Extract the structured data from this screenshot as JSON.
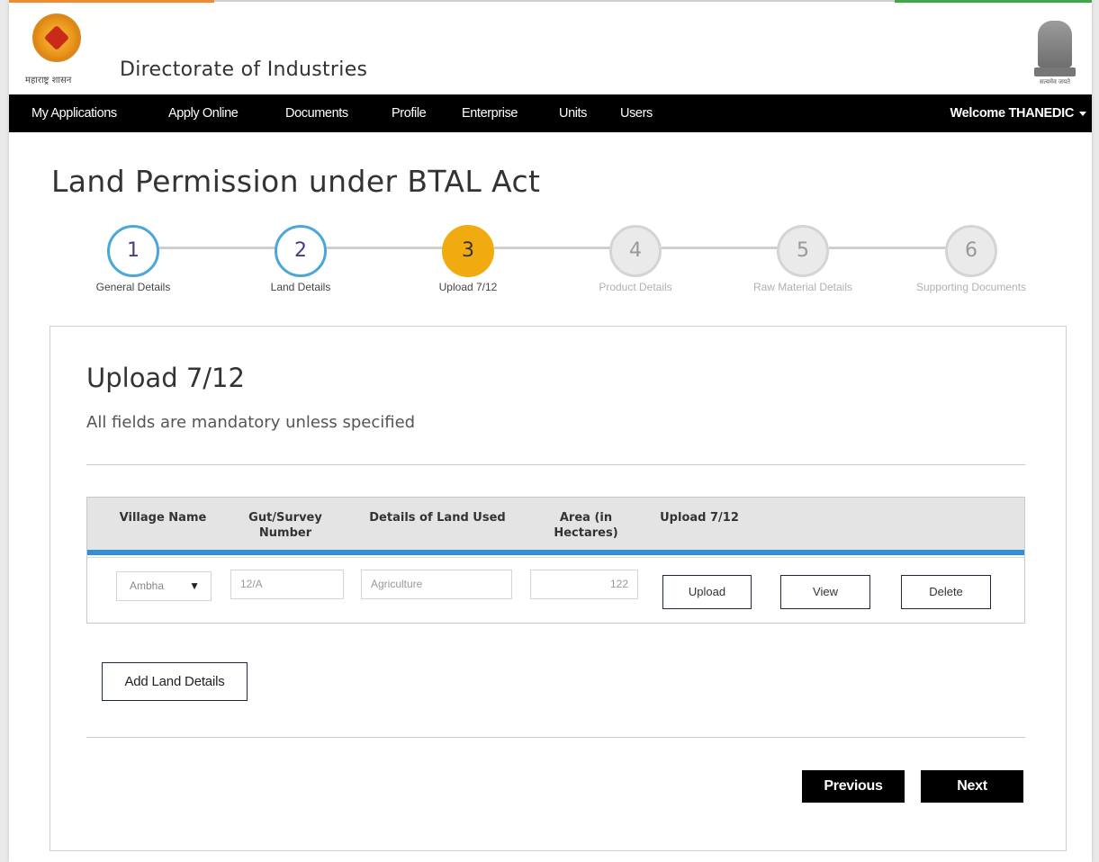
{
  "header": {
    "logo_caption": "महाराष्ट्र शासन",
    "title": "Directorate of Industries",
    "emblem_motto": "सत्यमेव जयते"
  },
  "nav": {
    "items": [
      "My Applications",
      "Apply Online",
      "Documents",
      "Profile",
      "Enterprise",
      "Units",
      "Users"
    ],
    "welcome": "Welcome THANEDIC"
  },
  "page_title": "Land Permission under BTAL Act",
  "steps": [
    {
      "number": "1",
      "label": "General Details",
      "state": "done"
    },
    {
      "number": "2",
      "label": "Land Details",
      "state": "done"
    },
    {
      "number": "3",
      "label": "Upload 7/12",
      "state": "active"
    },
    {
      "number": "4",
      "label": "Product Details",
      "state": "pending"
    },
    {
      "number": "5",
      "label": "Raw Material Details",
      "state": "pending"
    },
    {
      "number": "6",
      "label": "Supporting Documents",
      "state": "pending"
    }
  ],
  "section": {
    "title": "Upload 7/12",
    "subtitle": "All fields are mandatory unless specified"
  },
  "table": {
    "headers": {
      "village": "Village Name",
      "gut_line1": "Gut/Survey",
      "gut_line2": "Number",
      "details": "Details of Land Used",
      "area_line1": "Area (in",
      "area_line2": "Hectares)",
      "upload": "Upload 7/12"
    },
    "row": {
      "village": "Ambha",
      "gut": "12/A",
      "details": "Agriculture",
      "area": "122",
      "upload_label": "Upload",
      "view_label": "View",
      "delete_label": "Delete"
    }
  },
  "buttons": {
    "add_land": "Add Land Details",
    "previous": "Previous",
    "next": "Next"
  },
  "colors": {
    "step_done_border": "#4ba6d9",
    "step_active_fill": "#f0ab10",
    "table_accent": "#2f8fd8",
    "navbar": "#000000"
  },
  "icons": {
    "dropdown": "▼"
  }
}
